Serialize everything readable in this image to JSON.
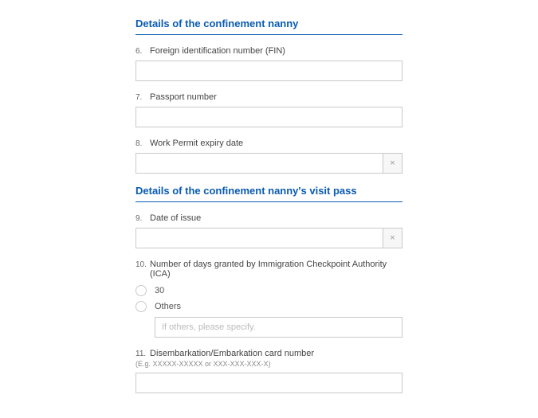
{
  "sections": {
    "nanny": {
      "title": "Details of the confinement nanny"
    },
    "visitpass": {
      "title": "Details of the confinement nanny's visit pass"
    }
  },
  "fields": {
    "fin": {
      "num": "6.",
      "label": "Foreign identification number (FIN)",
      "value": ""
    },
    "passport": {
      "num": "7.",
      "label": "Passport number",
      "value": ""
    },
    "wpexpiry": {
      "num": "8.",
      "label": "Work Permit expiry date",
      "value": "",
      "clear": "×"
    },
    "doi": {
      "num": "9.",
      "label": "Date of issue",
      "value": "",
      "clear": "×"
    },
    "days": {
      "num": "10.",
      "label": "Number of days granted by Immigration Checkpoint Authority (ICA)",
      "opt30": "30",
      "optOthers": "Others",
      "othersPlaceholder": "If others, please specify."
    },
    "decard": {
      "num": "11.",
      "label": "Disembarkation/Embarkation card number",
      "hint": "(E.g. XXXXX-XXXXX or XXX-XXX-XXX-X)",
      "value": ""
    }
  }
}
